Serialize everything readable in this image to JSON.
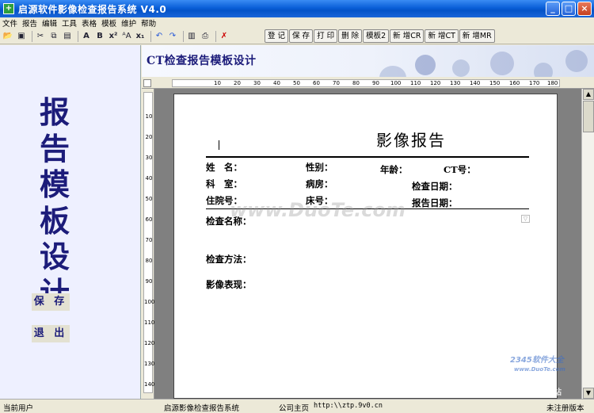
{
  "window": {
    "title": "启源软件影像检查报告系统   V4.0",
    "app_icon": "+",
    "minimize": "_",
    "maximize": "□",
    "close": "×"
  },
  "menu": [
    "文件",
    "报告",
    "编辑",
    "工具",
    "表格",
    "模板",
    "维护",
    "帮助"
  ],
  "toolbar": {
    "icons": [
      "open-icon",
      "save-icon",
      "cut-icon",
      "copy-icon",
      "paste-icon",
      "font-icon",
      "bold-icon",
      "superscript-icon",
      "font-size-icon",
      "subscript-icon",
      "undo-icon",
      "redo-icon",
      "layout-icon",
      "print-icon",
      "cross-icon"
    ],
    "buttons": [
      "登 记",
      "保 存",
      "打 印",
      "删 除",
      "模板2",
      "新 增CR",
      "新 增CT",
      "新 增MR"
    ]
  },
  "left_panel": {
    "title_chars": [
      "报",
      "告",
      "模",
      "板",
      "设",
      "计"
    ],
    "save_button": "保 存",
    "exit_button": "退 出"
  },
  "banner": {
    "title": "CT检查报告模板设计"
  },
  "ruler": {
    "h_ticks": [
      "10",
      "20",
      "30",
      "40",
      "50",
      "60",
      "70",
      "80",
      "90",
      "100",
      "110",
      "120",
      "130",
      "140",
      "150",
      "160",
      "170",
      "180"
    ],
    "v_ticks": [
      "10",
      "20",
      "30",
      "40",
      "50",
      "60",
      "70",
      "80",
      "90",
      "100",
      "110",
      "120",
      "130",
      "140"
    ]
  },
  "report": {
    "title": "影像报告",
    "name_label": "姓　名：",
    "sex_label": "性别：",
    "age_label": "年龄：",
    "ct_no_label": "CT号：",
    "dept_label": "科　室：",
    "ward_label": "病房：",
    "exam_date_label": "检查日期：",
    "admit_no_label": "住院号：",
    "bed_label": "床号：",
    "report_date_label": "报告日期：",
    "exam_name_label": "检查名称：",
    "exam_method_label": "检查方法：",
    "findings_label": "影像表现："
  },
  "watermarks": {
    "center": "www.DuoTe.com",
    "corner_brand": "2345软件大全",
    "corner_url": "www.DuoTe.com",
    "corner_slogan": "国内最安全的软件站"
  },
  "status": {
    "user": "当前用户",
    "app_name": "启源影像检查报告系统",
    "homepage_label": "公司主页",
    "url": "http:\\\\ztp.9v0.cn",
    "edition": "未注册版本"
  }
}
